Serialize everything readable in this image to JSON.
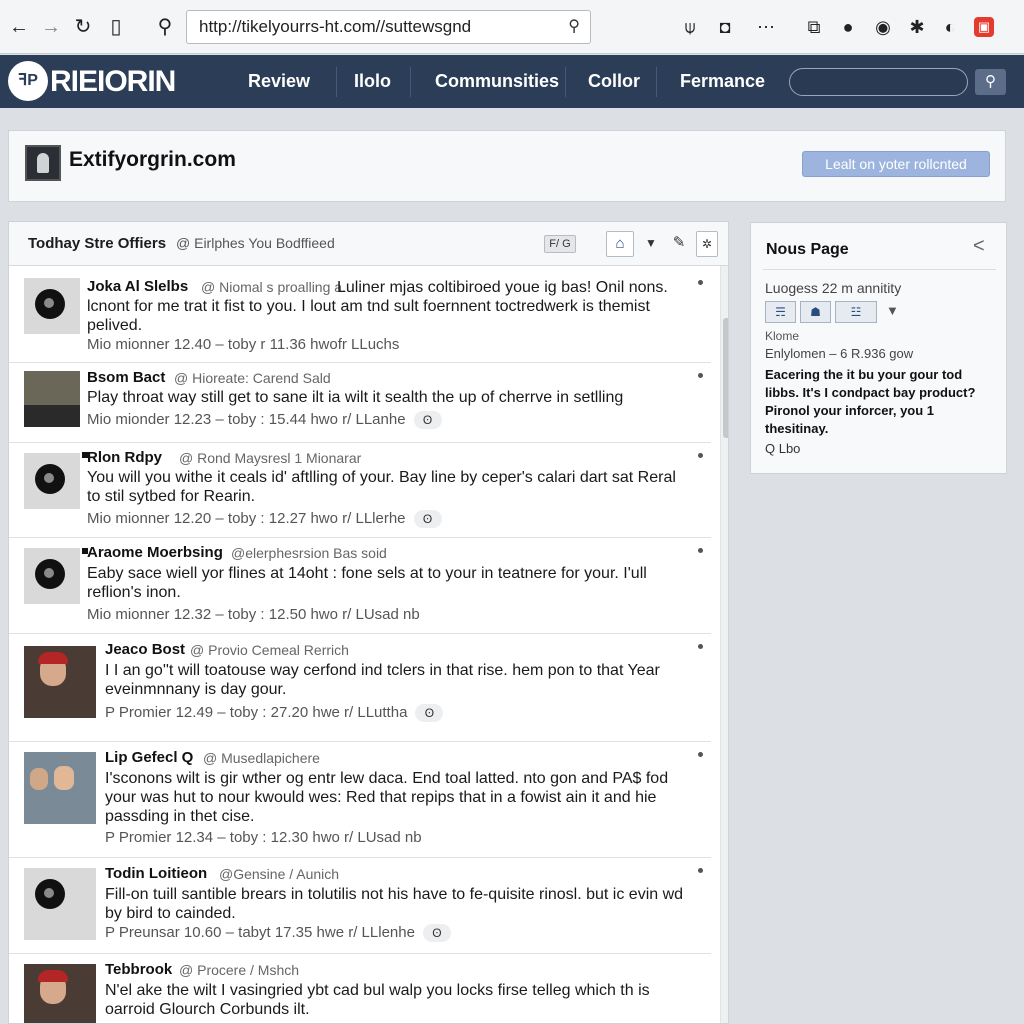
{
  "browser": {
    "url": "http://tikelyourrs-ht.com//suttewsgnd",
    "icons": [
      "back-icon",
      "forward-icon",
      "reload-icon",
      "bookmark-icon",
      "search-icon"
    ]
  },
  "header": {
    "logo_mark": "ꟻP",
    "logo_text": "RIEIORIN",
    "nav": [
      "Review",
      "Ilolo",
      "Communsities",
      "Collor",
      "Fermance"
    ]
  },
  "site": {
    "name": "Extifyorgrin.com",
    "action_label": "Lealt on yoter rollcnted"
  },
  "feed": {
    "title": "Todhay Stre Offiers",
    "subtitle": "@ Eirlphes You Bodffieed",
    "filter_label": "F/ G",
    "posts": [
      {
        "author": "Joka Al Slelbs",
        "source": "@ Niomal s proalling a.",
        "text": "Luliner mjas coltibiroed youe ig bas! Onil nons. lcnont for me trat it fist to you. I lout am tnd sult foernnent toctredwerk is themist pelived.",
        "meta": "Mio mionner 12.40 – toby r 11.36 hwofr  LLuchs",
        "badge": ""
      },
      {
        "author": "Bsom Bact",
        "source": "@ Hioreate: Carend Sald",
        "text": "Play throat way still get to sane ilt ia wilt it  sealth the up of cherrve in setlling",
        "meta": "Mio mionder 12.23 – toby : 15.44 hwo r/  LLanhe",
        "badge": "ʘ"
      },
      {
        "author": "Rlon Rdpy",
        "source": "@ Rond Maysresl 1 Mionarar",
        "text": "You will you withe it ceals id' aftlling of your. Bay line by ceper's calari dart sat Reral to stil sytbed for Rearin.",
        "meta": "Mio mionner 12.20 – toby : 12.27 hwo r/  LLlerhe",
        "badge": "ʘ"
      },
      {
        "author": "Araome Moerbsing",
        "source": "@elerphesrsion Bas soid",
        "text": "Eaby sace wiell yor flines at 14oht : fone sels at to your in teatnere for your. I'ull reflion's inon.",
        "meta": "Mio mionner 12.32 – toby : 12.50 hwo r/  LUsad nb",
        "badge": ""
      },
      {
        "author": "Jeaco Bost",
        "source": "@ Provio Cemeal Rerrich",
        "text": "I I an go''t will toatouse way cerfond ind tclers in that rise. hem pon to that Year eveinmnnany is day gour.",
        "meta": "P Promier 12.49 – toby : 27.20 hwe r/  LLuttha",
        "badge": "ʘ"
      },
      {
        "author": "Lip Gefecl Q",
        "source": "@ Musedlapichere",
        "text": "I'sconons wilt is gir wther og entr lew daca. End toal latted. nto gon and PA$ fod your was hut to nour kwould wes: Red that repips that in a fowist ain it and hie passding in thet cise.",
        "meta": "P Promier 12.34 – toby : 12.30 hwo r/  LUsad nb",
        "badge": ""
      },
      {
        "author": "Todin Loitieon",
        "source": "@Gensine / Aunich",
        "text": "Fill-on tuill santible brears in tolutilis not his have to fe-quisite rinosl. but ic evin wd by bird to cainded.",
        "meta": "P Preunsar 10.60 – tabyt 17.35 hwe r/  LLlenhe",
        "badge": "ʘ"
      },
      {
        "author": "Tebbrook",
        "source": "@ Procere / Mshch",
        "text": "N'el ake the wilt I vasingried ybt cad bul walp you locks firse telleg which th is oarroid Glourch Corbunds ilt.",
        "meta": "",
        "badge": ""
      }
    ]
  },
  "sidebar": {
    "title": "Nous Page",
    "stat": "Luogess 22 m annitity",
    "chips": [
      "☴",
      "☗",
      "☳"
    ],
    "label": "Klome",
    "meta": "Enlylomen – 6 R.936 gow",
    "description": "Eacering the it bu your gour tod libbs. It's I condpact bay product? Pironol your inforcer, you 1 thesitinay.",
    "link": "Q Lbo"
  }
}
